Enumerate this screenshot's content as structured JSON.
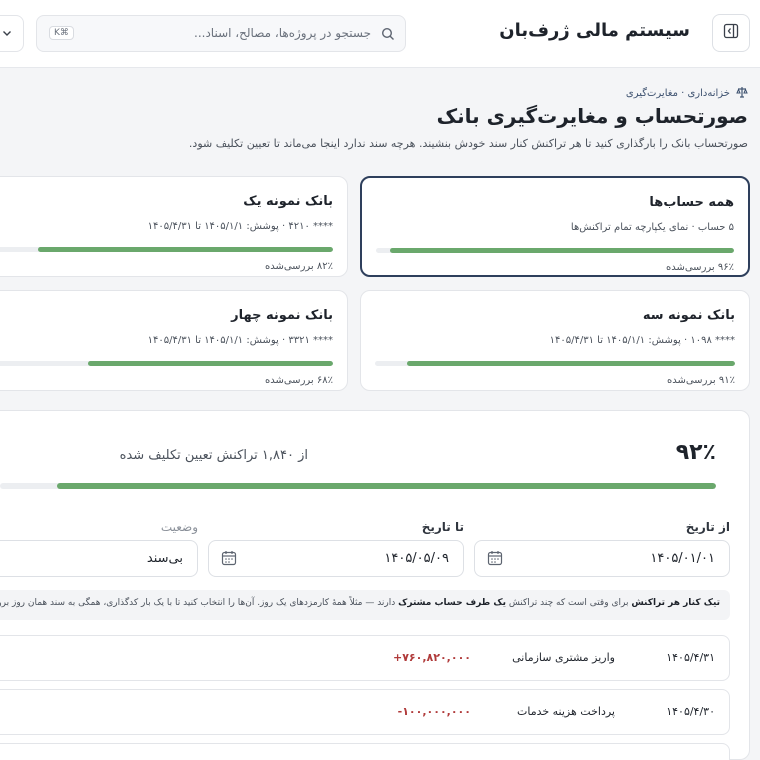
{
  "app": {
    "brand": "سیستم مالی ژرف‌بان"
  },
  "search": {
    "placeholder": "جستجو در پروژه‌ها، مصالح، اسناد...",
    "shortcut": "K⌘"
  },
  "breadcrumb": "خزانه‌داری · مغایرت‌گیری",
  "page": {
    "title": "صورتحساب و مغایرت‌گیری بانک",
    "subtitle": "صورتحساب بانک را بارگذاری کنید تا هر تراکنش کنار سند خودش بنشیند. هرچه سند ندارد اینجا می‌ماند تا تعیین تکلیف شود."
  },
  "accounts": [
    {
      "name": "همه حساب‌ها",
      "meta": "۵ حساب · نمای یکپارچه تمام تراکنش‌ها",
      "progress_label": "۹۶٪ بررسی‌شده",
      "progress": 96,
      "selected": true
    },
    {
      "name": "بانک نمونه یک",
      "meta": "**** ۴۲۱۰ · پوشش: ۱۴۰۵/۱/۱ تا ۱۴۰۵/۴/۳۱",
      "progress_label": "۸۲٪ بررسی‌شده",
      "progress": 82,
      "selected": false
    },
    {
      "name": "بانک نمونه سه",
      "meta": "**** ۱۰۹۸ · پوشش: ۱۴۰۵/۱/۱ تا ۱۴۰۵/۴/۳۱",
      "progress_label": "۹۱٪ بررسی‌شده",
      "progress": 91,
      "selected": false
    },
    {
      "name": "بانک نمونه چهار",
      "meta": "**** ۳۳۲۱ · پوشش: ۱۴۰۵/۱/۱ تا ۱۴۰۵/۴/۳۱",
      "progress_label": "۶۸٪ بررسی‌شده",
      "progress": 68,
      "selected": false
    }
  ],
  "summary": {
    "percent_label": "۹۲٪",
    "percent": 92,
    "text": "از ۱,۸۴۰ تراکنش تعیین تکلیف شده"
  },
  "filters": {
    "from_label": "از تاریخ",
    "from_value": "۱۴۰۵/۰۱/۰۱",
    "to_label": "تا تاریخ",
    "to_value": "۱۴۰۵/۰۵/۰۹",
    "status_label": "وضعیت",
    "status_value": "بی‌سند"
  },
  "hint": {
    "bold1": "تیک کنار هر تراکنش",
    "text1": " برای وقتی است که چند تراکنش ",
    "bold2": "یک طرف حساب مشترک",
    "text2": " دارند — مثلاً همهٔ کارمزدهای یک روز. آن‌ها را انتخاب کنید تا با یک بار کدگذاری، همگی به سند همان روز بروند. تیک کنار تاریخ"
  },
  "transactions": [
    {
      "date": "۱۴۰۵/۴/۳۱",
      "description": "واریز مشتری سازمانی",
      "amount": "+۷۶۰,۸۲۰,۰۰۰"
    },
    {
      "date": "۱۴۰۵/۴/۳۰",
      "description": "پرداخت هزینه خدمات",
      "amount": "-۱۰۰,۰۰۰,۰۰۰"
    }
  ],
  "colors": {
    "accent": "#2e3f5c",
    "progress": "#6aa86c",
    "amount": "#b03a3a"
  }
}
